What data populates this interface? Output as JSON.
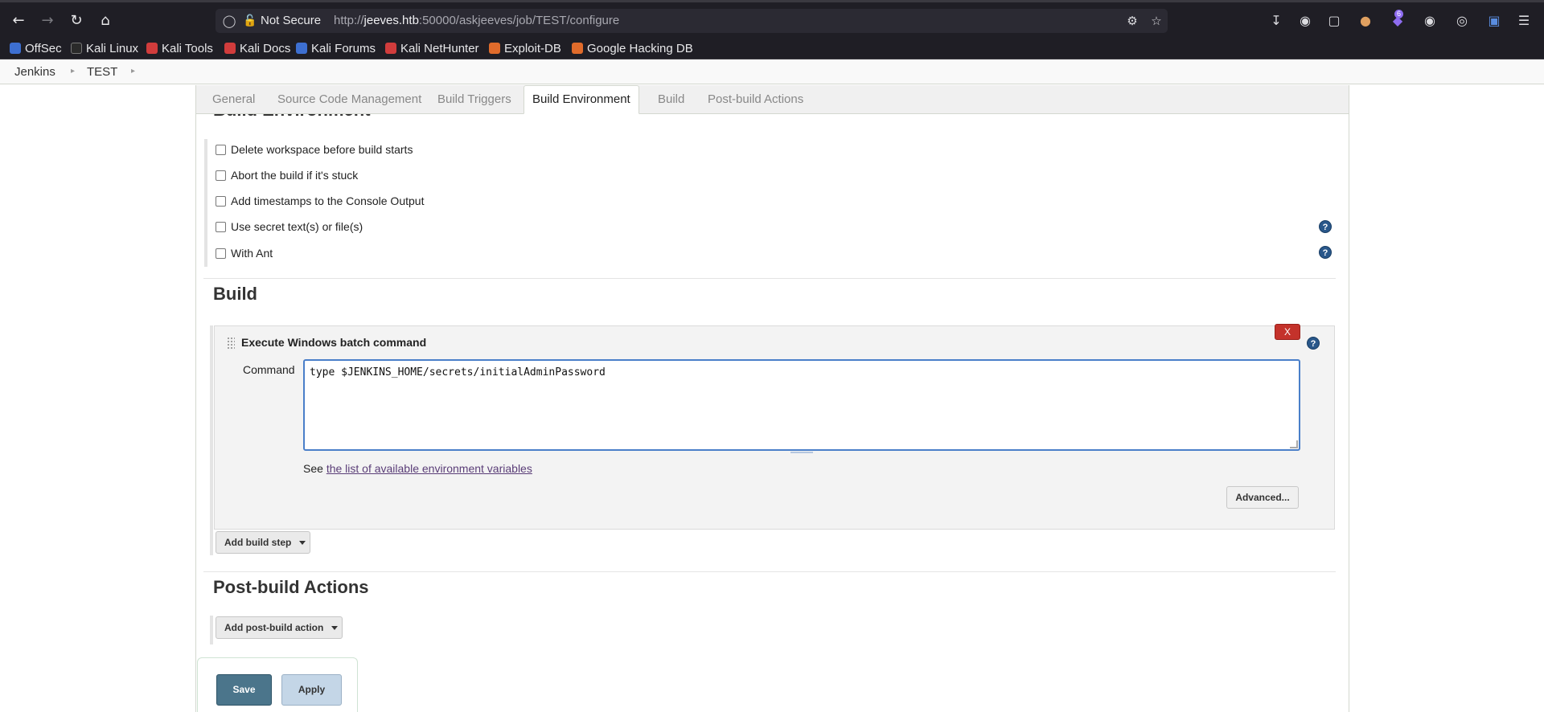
{
  "browser": {
    "nav_icons": {
      "back": "back-arrow-icon",
      "forward": "forward-arrow-icon",
      "reload": "reload-icon",
      "home": "home-icon"
    },
    "url_bar": {
      "security_label": "Not Secure",
      "url_prefix": "http://",
      "url_host": "jeeves.htb",
      "url_rest": ":50000/askjeeves/job/TEST/configure"
    },
    "bookmarks": [
      {
        "label": "OffSec",
        "color": "#3d6fd1"
      },
      {
        "label": "Kali Linux",
        "color": "#2a2a2a"
      },
      {
        "label": "Kali Tools",
        "color": "#d13c3c"
      },
      {
        "label": "Kali Docs",
        "color": "#d13c3c"
      },
      {
        "label": "Kali Forums",
        "color": "#3d6fd1"
      },
      {
        "label": "Kali NetHunter",
        "color": "#d13c3c"
      },
      {
        "label": "Exploit-DB",
        "color": "#e06b2b"
      },
      {
        "label": "Google Hacking DB",
        "color": "#e06b2b"
      }
    ],
    "extension_badge": "6"
  },
  "breadcrumb": {
    "items": [
      "Jenkins",
      "TEST"
    ]
  },
  "tabs": [
    {
      "label": "General",
      "active": false
    },
    {
      "label": "Source Code Management",
      "active": false
    },
    {
      "label": "Build Triggers",
      "active": false
    },
    {
      "label": "Build Environment",
      "active": true
    },
    {
      "label": "Build",
      "active": false
    },
    {
      "label": "Post-build Actions",
      "active": false
    }
  ],
  "build_environment": {
    "heading": "Build Environment",
    "options": [
      {
        "label": "Delete workspace before build starts",
        "checked": false
      },
      {
        "label": "Abort the build if it's stuck",
        "checked": false
      },
      {
        "label": "Add timestamps to the Console Output",
        "checked": false
      },
      {
        "label": "Use secret text(s) or file(s)",
        "checked": false
      },
      {
        "label": "With Ant",
        "checked": false
      }
    ]
  },
  "build": {
    "heading": "Build",
    "step": {
      "title": "Execute Windows batch command",
      "delete_label": "X",
      "command_label": "Command",
      "command_value": "type $JENKINS_HOME/secrets/initialAdminPassword",
      "envvars_prefix": "See",
      "envvars_link": "the list of available environment variables",
      "advanced_label": "Advanced..."
    },
    "add_step_label": "Add build step"
  },
  "post_build": {
    "heading": "Post-build Actions",
    "add_action_label": "Add post-build action"
  },
  "footer": {
    "save_label": "Save",
    "apply_label": "Apply"
  },
  "help_icon_text": "?"
}
